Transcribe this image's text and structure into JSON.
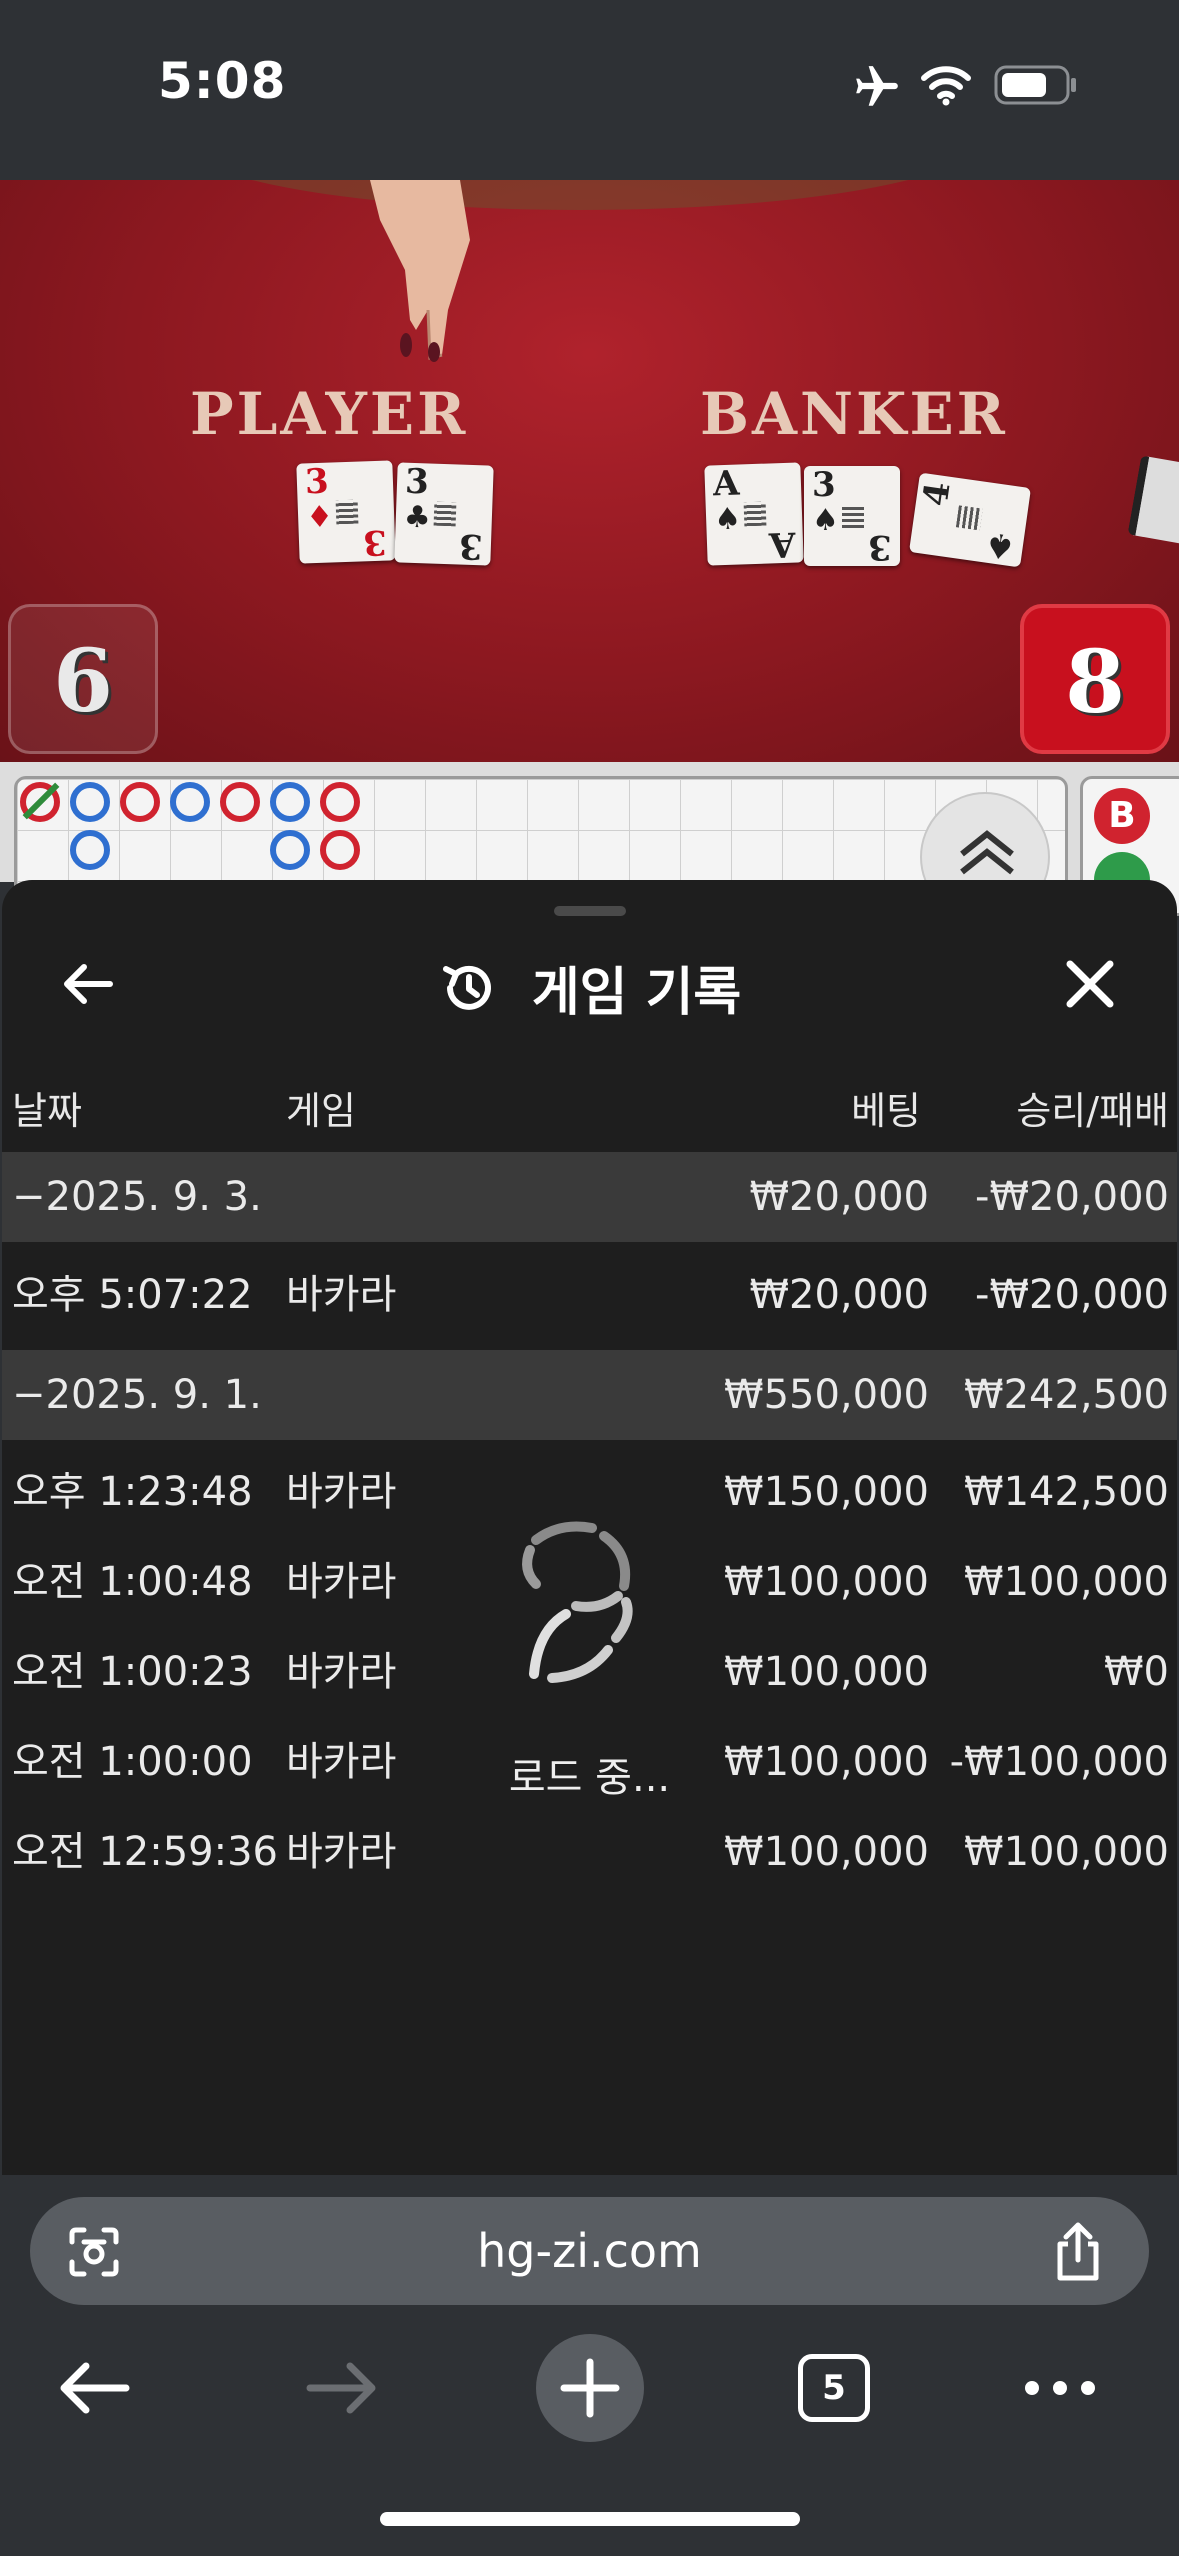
{
  "status_bar": {
    "time": "5:08"
  },
  "video": {
    "player_label": "PLAYER",
    "banker_label": "BANKER",
    "player_score": "6",
    "banker_score": "8",
    "player_cards": [
      {
        "rank": "3",
        "suit": "♦",
        "color": "red"
      },
      {
        "rank": "3",
        "suit": "♣",
        "color": "black"
      }
    ],
    "banker_cards": [
      {
        "rank": "A",
        "suit": "♠",
        "color": "black"
      },
      {
        "rank": "3",
        "suit": "♠",
        "color": "black"
      },
      {
        "rank": "4",
        "suit": "♠",
        "color": "black"
      }
    ],
    "side_badge": "B"
  },
  "sheet": {
    "title": "게임 기록",
    "columns": {
      "date": "날짜",
      "game": "게임",
      "bet": "베팅",
      "winloss": "승리/패배"
    },
    "groups": [
      {
        "date": "−2025. 9. 3.",
        "bet": "₩20,000",
        "winloss": "-₩20,000"
      },
      {
        "date": "−2025. 9. 1.",
        "bet": "₩550,000",
        "winloss": "₩242,500"
      }
    ],
    "rows": [
      {
        "time": "오후 5:07:22",
        "game": "바카라",
        "bet": "₩20,000",
        "winloss": "-₩20,000"
      },
      {
        "time": "오후 1:23:48",
        "game": "바카라",
        "bet": "₩150,000",
        "winloss": "₩142,500"
      },
      {
        "time": "오전 1:00:48",
        "game": "바카라",
        "bet": "₩100,000",
        "winloss": "₩100,000"
      },
      {
        "time": "오전 1:00:23",
        "game": "바카라",
        "bet": "₩100,000",
        "winloss": "₩0"
      },
      {
        "time": "오전 1:00:00",
        "game": "바카라",
        "bet": "₩100,000",
        "winloss": "-₩100,000"
      },
      {
        "time": "오전 12:59:36",
        "game": "바카라",
        "bet": "₩100,000",
        "winloss": "₩100,000"
      }
    ],
    "loading_text": "로드 중..."
  },
  "browser": {
    "url": "hg-zi.com",
    "tab_count": "5"
  },
  "colors": {
    "sheet_bg": "#1e1e1e",
    "group_row_bg": "#3a3a3a",
    "chrome_bg": "#2e3135",
    "table_red": "#9c1c24",
    "banker_score_bg": "#c8101e",
    "road_red": "#d0232f",
    "road_blue": "#2f6fd0"
  }
}
